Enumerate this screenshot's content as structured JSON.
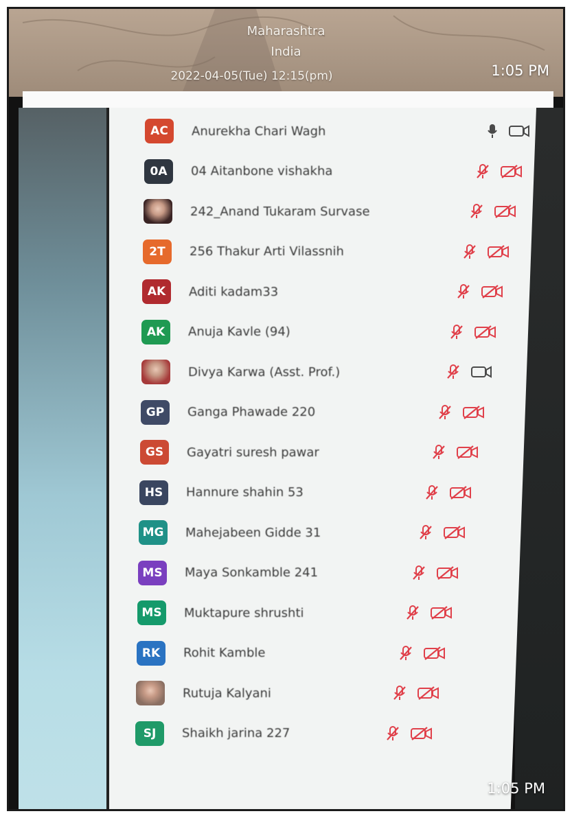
{
  "header": {
    "state": "Maharashtra",
    "country": "India",
    "datetime": "2022-04-05(Tue)   12:15(pm)",
    "time_top": "1:05 PM"
  },
  "time_bottom": "1:05 PM",
  "colors": {
    "muted_red": "#e0404a",
    "neutral_icon": "#4a4a4a"
  },
  "participants": [
    {
      "initials": "AC",
      "name": "Anurekha Chari Wagh",
      "avatar_color": "#d4482f",
      "mic": "on",
      "video": "off-neutral"
    },
    {
      "initials": "0A",
      "name": "04 Aitanbone vishakha",
      "avatar_color": "#2f3640",
      "mic": "muted",
      "video": "muted"
    },
    {
      "initials": "",
      "name": "242_Anand Tukaram Survase",
      "avatar_color": "#3a2424",
      "photo": true,
      "mic": "muted",
      "video": "muted"
    },
    {
      "initials": "2T",
      "name": "256 Thakur Arti Vilassnih",
      "avatar_color": "#e66a2c",
      "mic": "muted",
      "video": "muted"
    },
    {
      "initials": "AK",
      "name": "Aditi kadam33",
      "avatar_color": "#b02a2f",
      "mic": "muted",
      "video": "muted"
    },
    {
      "initials": "AK",
      "name": "Anuja Kavle (94)",
      "avatar_color": "#1f9a52",
      "mic": "muted",
      "video": "muted"
    },
    {
      "initials": "",
      "name": "Divya Karwa (Asst. Prof.)",
      "avatar_color": "#a63a3a",
      "photo": true,
      "mic": "muted",
      "video": "off-neutral"
    },
    {
      "initials": "GP",
      "name": "Ganga Phawade 220",
      "avatar_color": "#3f4a66",
      "mic": "muted",
      "video": "muted"
    },
    {
      "initials": "GS",
      "name": "Gayatri suresh pawar",
      "avatar_color": "#cc4a34",
      "mic": "muted",
      "video": "muted"
    },
    {
      "initials": "HS",
      "name": "Hannure shahin 53",
      "avatar_color": "#3a4660",
      "mic": "muted",
      "video": "muted"
    },
    {
      "initials": "MG",
      "name": "Mahejabeen Gidde 31",
      "avatar_color": "#1f9187",
      "mic": "muted",
      "video": "muted"
    },
    {
      "initials": "MS",
      "name": "Maya Sonkamble 241",
      "avatar_color": "#7a3fbf",
      "mic": "muted",
      "video": "muted"
    },
    {
      "initials": "MS",
      "name": "Muktapure shrushti",
      "avatar_color": "#159a6b",
      "mic": "muted",
      "video": "muted"
    },
    {
      "initials": "RK",
      "name": "Rohit Kamble",
      "avatar_color": "#2a73c2",
      "mic": "muted",
      "video": "muted"
    },
    {
      "initials": "",
      "name": "Rutuja Kalyani",
      "avatar_color": "#8a6f62",
      "photo": true,
      "mic": "muted",
      "video": "muted"
    },
    {
      "initials": "SJ",
      "name": "Shaikh jarina 227",
      "avatar_color": "#1f9a68",
      "mic": "muted",
      "video": "muted"
    }
  ]
}
